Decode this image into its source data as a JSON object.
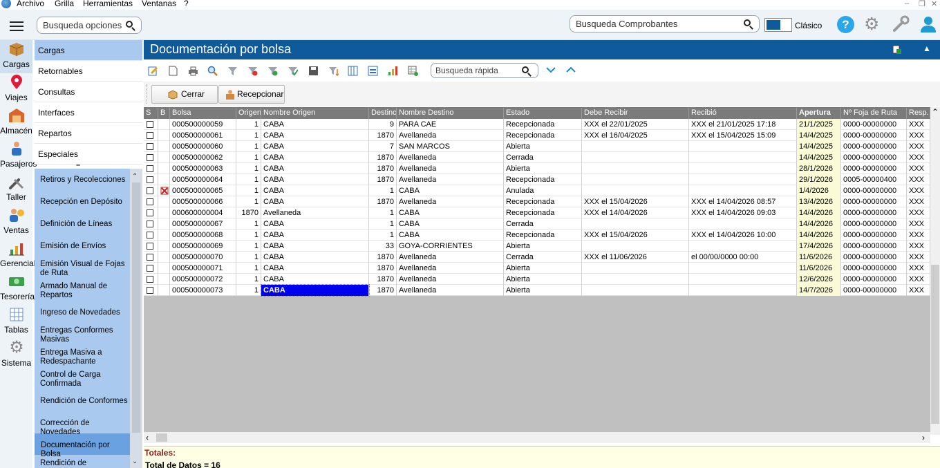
{
  "menubar": {
    "items": [
      "Archivo",
      "Grilla",
      "Herramientas",
      "Ventanas",
      "?"
    ]
  },
  "topbar": {
    "search_options_placeholder": "Busqueda opciones",
    "search_vouchers_placeholder": "Busqueda Comprobantes",
    "mode_label": "Clásico"
  },
  "rail": [
    {
      "label": "Cargas",
      "icon": "box-icon"
    },
    {
      "label": "Viajes",
      "icon": "map-pin-icon"
    },
    {
      "label": "Almacén",
      "icon": "warehouse-icon"
    },
    {
      "label": "Pasajeros",
      "icon": "passenger-icon"
    },
    {
      "label": "Taller",
      "icon": "tools-icon"
    },
    {
      "label": "Ventas",
      "icon": "sales-icon"
    },
    {
      "label": "Gerencial",
      "icon": "chart-icon"
    },
    {
      "label": "Tesorería",
      "icon": "money-icon"
    },
    {
      "label": "Tablas",
      "icon": "table-icon"
    },
    {
      "label": "Sistema",
      "icon": "gear-icon"
    }
  ],
  "subtabs": [
    "Cargas",
    "Retornables",
    "Consultas",
    "Interfaces",
    "Repartos",
    "Especiales"
  ],
  "submenu": [
    "Retiros y Recolecciones",
    "Recepción en Depósito",
    "Definición de Líneas",
    "Emisión de Envíos",
    "Emisión Visual de Fojas de Ruta",
    "Armado Manual de Repartos",
    "Ingreso de Novedades",
    "Entregas Conformes Masivas",
    "Entrega Masiva a Redespachante",
    "Control de Carga Confirmada",
    "Rendición de Conformes",
    "Corrección de Novedades",
    "Documentación por Bolsa",
    "Rendición de"
  ],
  "title": "Documentación por bolsa",
  "quick_search_placeholder": "Busqueda rápida",
  "actions": {
    "close": "Cerrar",
    "receive": "Recepcionar"
  },
  "columns": [
    "S",
    "B",
    "Bolsa",
    "Origen",
    "Nombre Origen",
    "Destino",
    "Nombre Destino",
    "Estado",
    "Debe Recibir",
    "Recibió",
    "Apertura",
    "Nº Foja de Ruta",
    "Resp."
  ],
  "rows": [
    [
      "000500000059",
      "1",
      "CABA",
      "9",
      "PARA CAE",
      "Recepcionada",
      "XXX el 22/01/2025",
      "XXX el 21/01/2025 17:18",
      "21/1/2025",
      "0000-00000000",
      "XXX"
    ],
    [
      "000500000061",
      "1",
      "CABA",
      "1870",
      "Avellaneda",
      "Recepcionada",
      "XXX el 16/04/2025",
      "XXX el 15/04/2025 15:09",
      "14/4/2025",
      "0000-00000000",
      "XXX"
    ],
    [
      "000500000060",
      "1",
      "CABA",
      "7",
      "SAN MARCOS",
      "Abierta",
      "",
      "",
      "14/4/2025",
      "0000-00000000",
      "XXX"
    ],
    [
      "000500000062",
      "1",
      "CABA",
      "1870",
      "Avellaneda",
      "Cerrada",
      "",
      "",
      "14/4/2025",
      "0000-00000000",
      "XXX"
    ],
    [
      "000500000063",
      "1",
      "CABA",
      "1870",
      "Avellaneda",
      "Abierta",
      "",
      "",
      "28/1/2026",
      "0000-00000000",
      "XXX"
    ],
    [
      "000500000064",
      "1",
      "CABA",
      "1870",
      "Avellaneda",
      "Recepcionada",
      "",
      "",
      "29/1/2026",
      "0005-00000400",
      "XXX"
    ],
    [
      "000500000065",
      "1",
      "CABA",
      "1",
      "CABA",
      "Anulada",
      "",
      "",
      "1/4/2026",
      "0000-00000000",
      "XXX"
    ],
    [
      "000500000066",
      "1",
      "CABA",
      "1870",
      "Avellaneda",
      "Recepcionada",
      "XXX el 15/04/2026",
      "XXX el 14/04/2026 08:57",
      "13/4/2026",
      "0000-00000000",
      "XXX"
    ],
    [
      "000600000004",
      "1870",
      "Avellaneda",
      "1",
      "CABA",
      "Recepcionada",
      "XXX el 14/04/2026",
      "XXX el 14/04/2026 09:03",
      "14/4/2026",
      "0000-00000000",
      "XXX"
    ],
    [
      "000500000067",
      "1",
      "CABA",
      "1",
      "CABA",
      "Cerrada",
      "",
      "",
      "14/4/2026",
      "0000-00000000",
      "XXX"
    ],
    [
      "000500000068",
      "1",
      "CABA",
      "1",
      "CABA",
      "Recepcionada",
      "XXX el 15/04/2026",
      "XXX el 14/04/2026 10:00",
      "14/4/2026",
      "0000-00000000",
      "XXX"
    ],
    [
      "000500000069",
      "1",
      "CABA",
      "33",
      "GOYA-CORRIENTES",
      "Abierta",
      "",
      "",
      "17/4/2026",
      "0000-00000000",
      "XXX"
    ],
    [
      "000500000070",
      "1",
      "CABA",
      "1870",
      "Avellaneda",
      "Cerrada",
      "XXX el 11/06/2026",
      " el 00/00/0000 00:00",
      "11/6/2026",
      "0000-00000000",
      "XXX"
    ],
    [
      "000500000071",
      "1",
      "CABA",
      "1870",
      "Avellaneda",
      "Abierta",
      "",
      "",
      "11/6/2026",
      "0000-00000000",
      "XXX"
    ],
    [
      "000500000072",
      "1",
      "CABA",
      "1870",
      "Avellaneda",
      "Abierta",
      "",
      "",
      "12/6/2026",
      "0000-00000000",
      "XXX"
    ],
    [
      "000500000073",
      "1",
      "CABA",
      "1870",
      "Avellaneda",
      "Abierta",
      "",
      "",
      "14/7/2026",
      "0000-00000000",
      "XXX"
    ]
  ],
  "totals": {
    "label": "Totales:",
    "count": "Total de Datos = 16"
  },
  "colors": {
    "titlebar": "#0e5a9b",
    "submenu_bg": "#aac9ef",
    "selected_submenu": "#6aa2e1",
    "selected_cell": "#0000ee",
    "apertura_bg": "#fafad7"
  }
}
